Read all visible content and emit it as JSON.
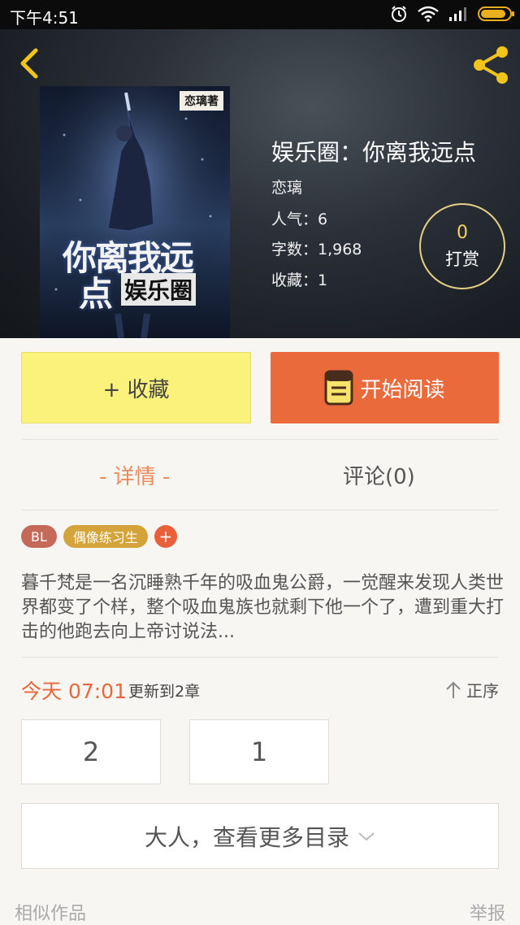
{
  "status_bar": {
    "time": "下午4:51",
    "icons": [
      "alarm-icon",
      "wifi-icon",
      "signal-icon",
      "battery-icon"
    ],
    "battery_level": 0.9,
    "icon_color": "#e8b01e"
  },
  "header": {
    "back_icon": "back-chevron-icon",
    "share_icon": "share-icon",
    "accent_color": "#f0c419"
  },
  "cover": {
    "author_tag": "恋璃著",
    "title_line1": "你离我远",
    "title_line2": "点",
    "title_line3": "娱乐圈"
  },
  "book": {
    "title": "娱乐圈：你离我远点",
    "author": "恋璃",
    "popularity": "人气：6",
    "word_count": "字数：1,968",
    "favorites": "收藏：1"
  },
  "reward": {
    "count": "0",
    "label": "打赏"
  },
  "actions": {
    "favorite_label": "+ 收藏",
    "read_label": "开始阅读",
    "read_icon": "book-icon",
    "favorite_color": "#fbf27c",
    "read_color": "#ea6a3c"
  },
  "tabs": {
    "detail": "- 详情 -",
    "comments": "评论(0)"
  },
  "tags": [
    "BL",
    "偶像练习生"
  ],
  "add_tag_symbol": "+",
  "description": "暮千梵是一名沉睡熟千年的吸血鬼公爵，一觉醒来发现人类世界都变了个样，整个吸血鬼族也就剩下他一个了，遭到重大打击的他跑去向上帝讨说法...",
  "update": {
    "time": "今天 07:01",
    "text": "更新到2章",
    "sort_label": "正序",
    "sort_icon": "arrow-up-icon"
  },
  "chapters": [
    "2",
    "1"
  ],
  "more_catalog": "大人，查看更多目录",
  "footer": {
    "similar": "相似作品",
    "report": "举报"
  }
}
